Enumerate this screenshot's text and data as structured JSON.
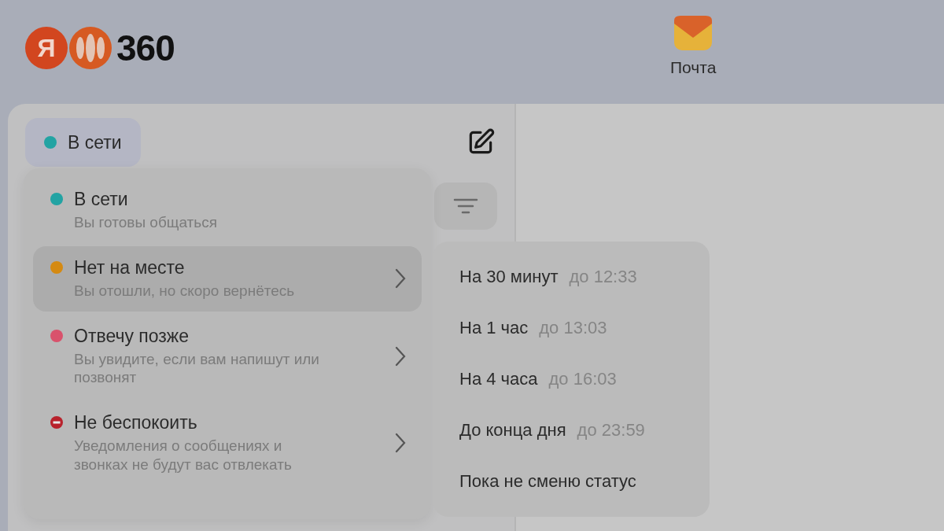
{
  "header": {
    "logo": {
      "letter": "Я",
      "text": "360"
    },
    "apps": [
      {
        "label": "Почта"
      }
    ]
  },
  "status_button": {
    "label": "В сети",
    "color": "#22a3a3"
  },
  "status_menu": {
    "items": [
      {
        "kind": "dot",
        "title": "В сети",
        "subtitle": "Вы готовы общаться",
        "color": "#22a3a3",
        "selected": false,
        "submenu": false
      },
      {
        "kind": "dot",
        "title": "Нет на месте",
        "subtitle": "Вы отошли, но скоро вернётесь",
        "color": "#d58a12",
        "selected": true,
        "submenu": true
      },
      {
        "kind": "dot",
        "title": "Отвечу позже",
        "subtitle": "Вы увидите, если вам напишут или позвонят",
        "color": "#d9526c",
        "selected": false,
        "submenu": true
      },
      {
        "kind": "blocked",
        "title": "Не беспокоить",
        "subtitle": "Уведомления о сообщениях и звонках не будут вас отвлекать",
        "color": "#b8222c",
        "selected": false,
        "submenu": true
      }
    ]
  },
  "duration_menu": {
    "items": [
      {
        "label": "На 30 минут",
        "until": "до 12:33"
      },
      {
        "label": "На 1 час",
        "until": "до 13:03"
      },
      {
        "label": "На 4 часа",
        "until": "до 16:03"
      },
      {
        "label": "До конца дня",
        "until": "до 23:59"
      },
      {
        "label": "Пока не сменю статус"
      }
    ]
  }
}
